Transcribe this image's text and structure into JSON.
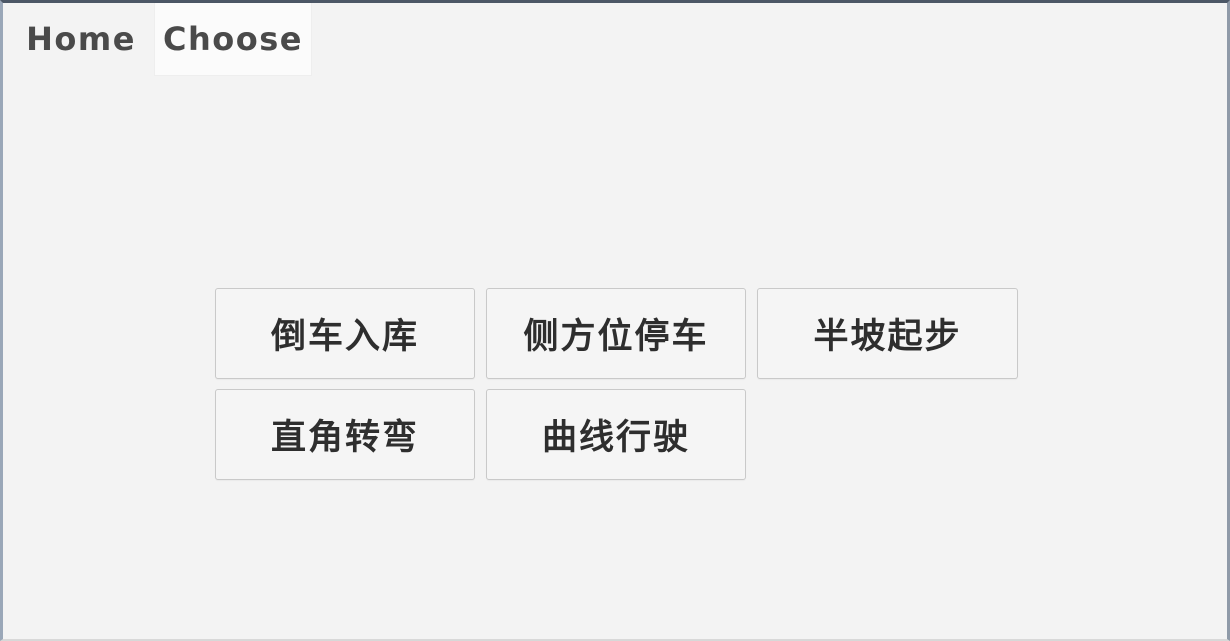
{
  "window": {
    "background_color": "#f3f3f3",
    "border_color_top": "#4c5766",
    "border_color_side": "#9aa7b8"
  },
  "tabs": [
    {
      "id": "home",
      "label": "Home",
      "active": false
    },
    {
      "id": "choose",
      "label": "Choose",
      "active": true
    }
  ],
  "main": {
    "grid": {
      "rows": [
        {
          "buttons": [
            {
              "id": "reverse-parking",
              "label": "倒车入库"
            },
            {
              "id": "parallel-parking",
              "label": "侧方位停车"
            },
            {
              "id": "hill-start",
              "label": "半坡起步"
            }
          ]
        },
        {
          "buttons": [
            {
              "id": "right-angle-turn",
              "label": "直角转弯"
            },
            {
              "id": "curve-driving",
              "label": "曲线行驶"
            }
          ]
        }
      ]
    },
    "button_style": {
      "background": "#f5f5f5",
      "border_color": "#c9c9c9",
      "text_color": "#2e2e2e"
    }
  }
}
